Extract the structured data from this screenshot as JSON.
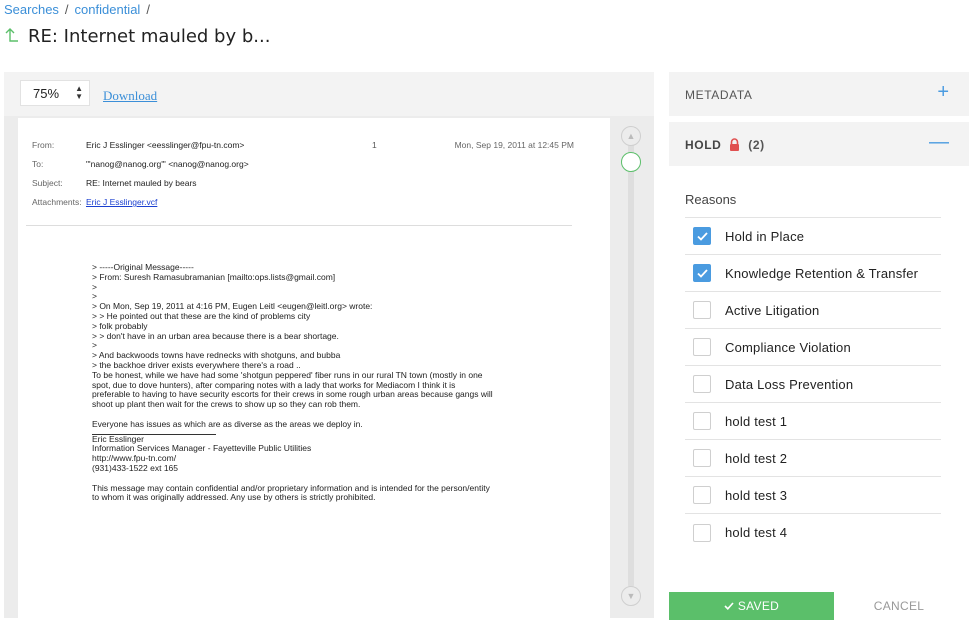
{
  "breadcrumb": {
    "items": [
      "Searches",
      "confidential"
    ],
    "separator": "/"
  },
  "page": {
    "title": "RE: Internet mauled by b..."
  },
  "viewer": {
    "zoom": "75%",
    "download_label": "Download",
    "email": {
      "from_label": "From:",
      "from": "Eric J Esslinger <eesslinger@fpu-tn.com>",
      "to_label": "To:",
      "to": "\"'nanog@nanog.org'\" <nanog@nanog.org>",
      "subject_label": "Subject:",
      "subject": "RE: Internet mauled by bears",
      "attachments_label": "Attachments:",
      "attachment": "Eric J Esslinger.vcf",
      "page_number": "1",
      "date": "Mon, Sep 19, 2011 at 12:45 PM",
      "body_lines": [
        "> -----Original Message-----",
        "> From: Suresh Ramasubramanian [mailto:ops.lists@gmail.com]",
        ">",
        ">",
        "> On Mon, Sep 19, 2011 at 4:16 PM, Eugen Leitl <eugen@leitl.org> wrote:",
        "> > He pointed out that these are the kind of problems city",
        "> folk probably",
        "> > don't have in an urban area because there is a bear shortage.",
        ">",
        "> And backwoods towns have rednecks with shotguns, and bubba",
        "> the backhoe driver exists everywhere there's a road ..",
        "To be honest, while we have had some 'shotgun peppered' fiber runs in our rural TN town (mostly in one",
        "spot, due to dove hunters), after comparing notes with a lady that works for Mediacom I think it is",
        "preferable to having to have security escorts for their crews in some rough urban areas because gangs will",
        "shoot up plant then wait for the crews to show up so they can rob them."
      ],
      "closing": "Everyone has issues as which are as diverse as the areas we deploy in.",
      "signature": [
        "Eric Esslinger",
        "Information Services Manager - Fayetteville Public Utilities",
        "http://www.fpu-tn.com/",
        "(931)433-1522 ext 165"
      ],
      "disclaimer": [
        "This message may contain confidential and/or proprietary information and is intended for the person/entity",
        "to whom it was originally addressed. Any use by others is strictly prohibited."
      ]
    }
  },
  "panel": {
    "metadata_title": "METADATA",
    "metadata_toggle": "+",
    "hold_title": "HOLD",
    "hold_count": "(2)",
    "hold_toggle": "—",
    "reasons_label": "Reasons",
    "reasons": [
      {
        "label": "Hold in Place",
        "checked": true
      },
      {
        "label": "Knowledge Retention & Transfer",
        "checked": true
      },
      {
        "label": "Active Litigation",
        "checked": false
      },
      {
        "label": "Compliance Violation",
        "checked": false
      },
      {
        "label": "Data Loss Prevention",
        "checked": false
      },
      {
        "label": "hold test 1",
        "checked": false
      },
      {
        "label": "hold test 2",
        "checked": false
      },
      {
        "label": "hold test 3",
        "checked": false
      },
      {
        "label": "hold test 4",
        "checked": false
      }
    ],
    "save_label": "SAVED",
    "cancel_label": "CANCEL"
  },
  "colors": {
    "accent": "#4a9be0",
    "success": "#5bbf6a",
    "lock": "#e05050",
    "link": "#3b8fd8"
  },
  "icons": [
    "up-arrow-icon",
    "lock-icon",
    "checkmark-icon",
    "scroll-up-icon",
    "scroll-down-icon"
  ]
}
